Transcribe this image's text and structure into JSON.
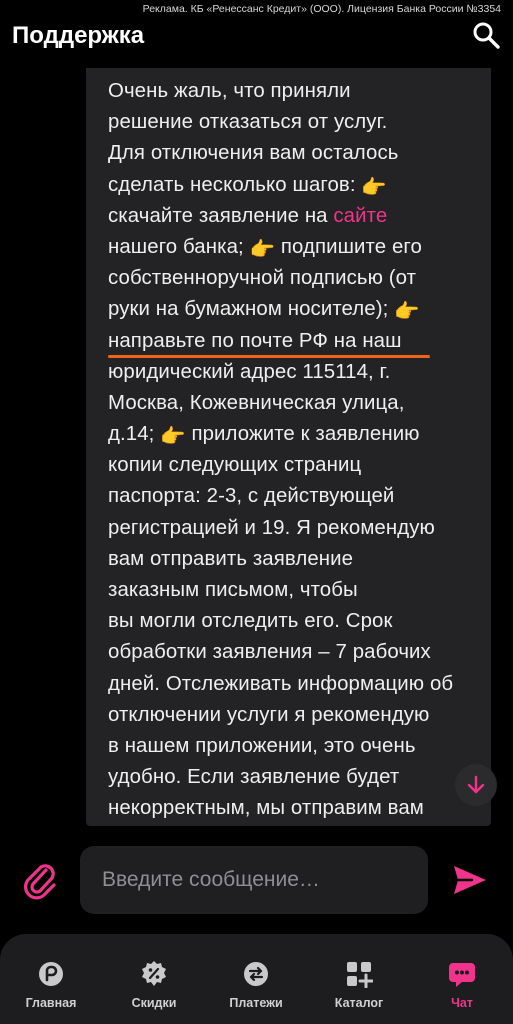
{
  "ad_text": "Реклама. КБ «Ренессанс Кредит» (ООО). Лицензия Банка России №3354",
  "header": {
    "title": "Поддержка",
    "search_icon": "search-icon"
  },
  "message": {
    "lines": [
      "Очень жаль, что приняли",
      "решение отказаться от услуг.",
      "Для отключения вам осталось",
      "сделать несколько шагов:",
      "скачайте заявление на",
      "нашего банка;",
      "собственноручной подписью (от",
      "руки на бумажном носителе);",
      "направьте по почте РФ на наш",
      "юридический адрес 115114, г.",
      "Москва, Кожевническая улица,",
      "д.14;",
      "копии следующих страниц",
      "паспорта: 2-3, с действующей",
      "регистрацией и 19. Я рекомендую",
      "вам отправить заявление",
      "заказным письмом, чтобы",
      "вы могли отследить его. Срок",
      "обработки заявления – 7 рабочих",
      "дней. Отслеживать информацию об",
      "отключении услуги я рекомендую",
      "в нашем приложении, это очень",
      "удобно. Если заявление будет",
      "некорректным, мы отправим вам"
    ],
    "link_text": "сайте",
    "line6_tail": "подпишите его",
    "line12_tail": "приложите к заявлению",
    "pointing_emoji": "👉",
    "highlight_color": "#f0641a",
    "link_color": "#f0338b"
  },
  "composer": {
    "placeholder": "Введите сообщение…"
  },
  "nav": {
    "items": [
      {
        "label": "Главная",
        "icon": "home-icon"
      },
      {
        "label": "Скидки",
        "icon": "discount-icon"
      },
      {
        "label": "Платежи",
        "icon": "payments-icon"
      },
      {
        "label": "Каталог",
        "icon": "catalog-icon"
      },
      {
        "label": "Чат",
        "icon": "chat-icon"
      }
    ],
    "active_index": 4,
    "accent_color": "#f0338b"
  }
}
